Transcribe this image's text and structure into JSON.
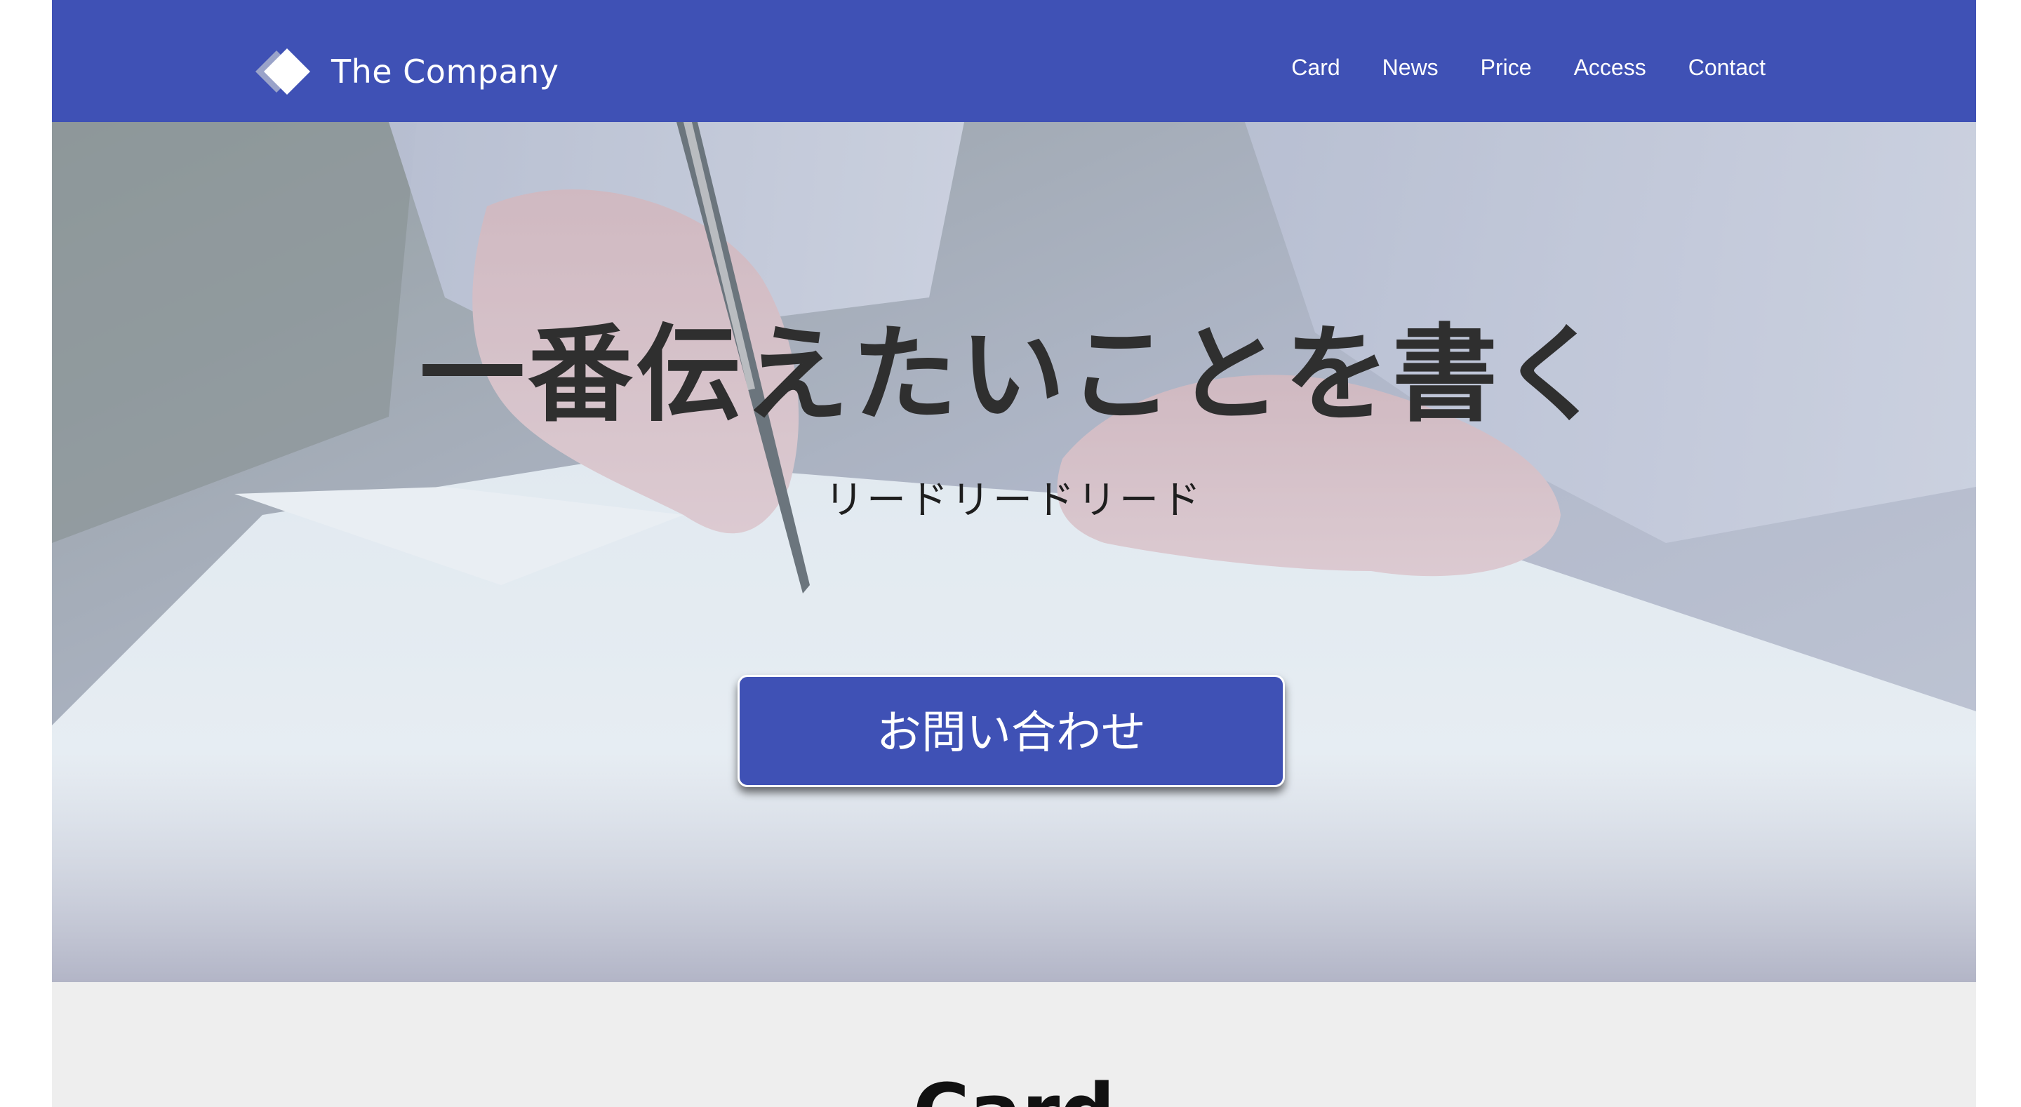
{
  "header": {
    "logo_text": "The Company",
    "nav": [
      {
        "label": "Card"
      },
      {
        "label": "News"
      },
      {
        "label": "Price"
      },
      {
        "label": "Access"
      },
      {
        "label": "Contact"
      }
    ]
  },
  "hero": {
    "title": "一番伝えたいことを書く",
    "lead": "リードリードリード",
    "button_label": "お問い合わせ"
  },
  "section": {
    "title": "Card"
  },
  "colors": {
    "brand": "#3f51b5",
    "section_bg": "#eeeeee",
    "title_text": "#2f2f2f"
  },
  "icons": {
    "logo": "diamond-logo-icon"
  }
}
